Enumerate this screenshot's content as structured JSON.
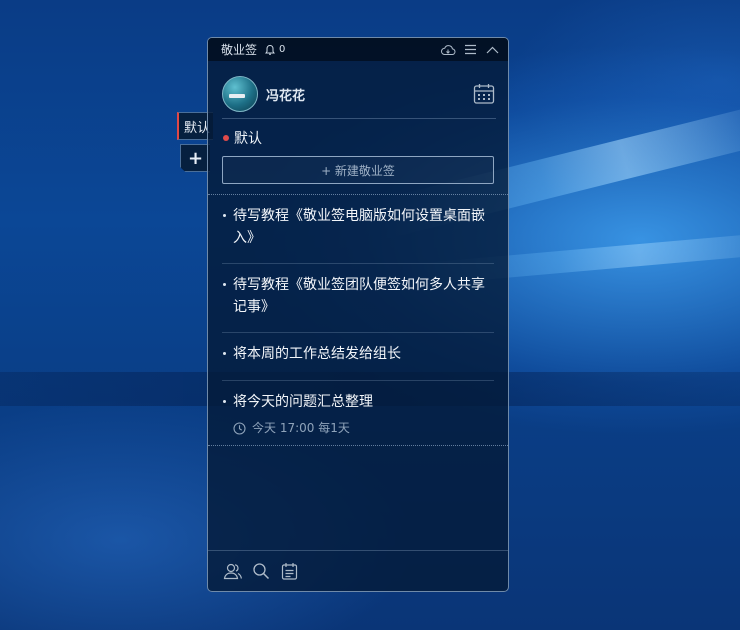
{
  "app": {
    "name": "敬业签",
    "notification_count": "0"
  },
  "side_tabs": {
    "category_label": "默认",
    "add_label": "+"
  },
  "profile": {
    "username": "冯花花"
  },
  "category": {
    "name": "默认",
    "color": "#e04b4b"
  },
  "new_note_button": {
    "label": "+ 新建敬业签"
  },
  "notes": [
    {
      "text": "待写教程《敬业签电脑版如何设置桌面嵌入》"
    },
    {
      "text": "待写教程《敬业签团队便签如何多人共享记事》"
    },
    {
      "text": "将本周的工作总结发给组长"
    },
    {
      "text": "将今天的问题汇总整理",
      "reminder": "今天 17:00 每1天"
    }
  ],
  "icons": {
    "title_bar": [
      "bell-icon",
      "cloud-sync-icon",
      "menu-icon",
      "collapse-icon"
    ],
    "header": [
      "calendar-icon"
    ],
    "footer": [
      "team-icon",
      "search-icon",
      "notes-list-icon"
    ],
    "note_meta": [
      "clock-icon"
    ]
  }
}
